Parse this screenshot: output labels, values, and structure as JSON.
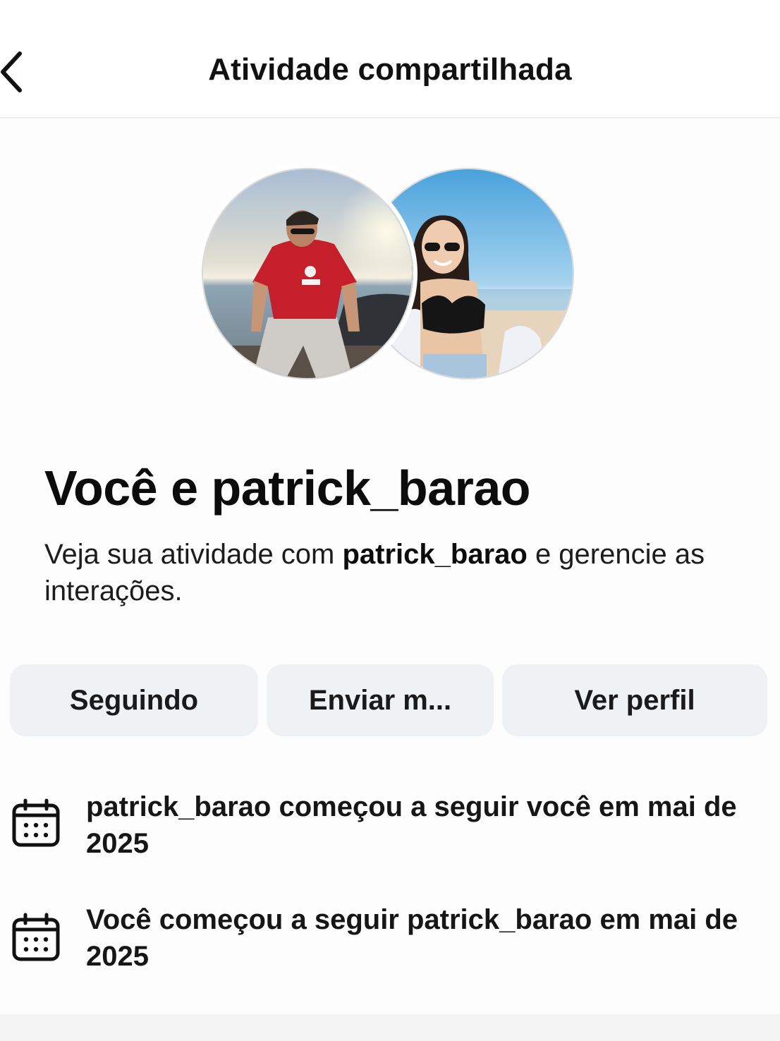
{
  "header": {
    "title": "Atividade compartilhada",
    "back_icon": "chevron-left-icon"
  },
  "avatars": {
    "you": "avatar-photo-man-red-shirt-beach",
    "other": "avatar-photo-woman-sunglasses-beach"
  },
  "main": {
    "title": "Você e patrick_barao",
    "description_prefix": "Veja sua atividade com ",
    "description_username": "patrick_barao",
    "description_suffix": " e gerencie as interações."
  },
  "actions": {
    "following_label": "Seguindo",
    "message_label": "Enviar m...",
    "profile_label": "Ver perfil"
  },
  "activity": [
    {
      "icon": "calendar-icon",
      "text": "patrick_barao começou a seguir você em mai de 2025"
    },
    {
      "icon": "calendar-icon",
      "text": "Você começou a seguir patrick_barao em mai de 2025"
    }
  ],
  "colors": {
    "button_bg": "#eff2f4",
    "text": "#0c0c0c",
    "divider": "#efefef"
  }
}
